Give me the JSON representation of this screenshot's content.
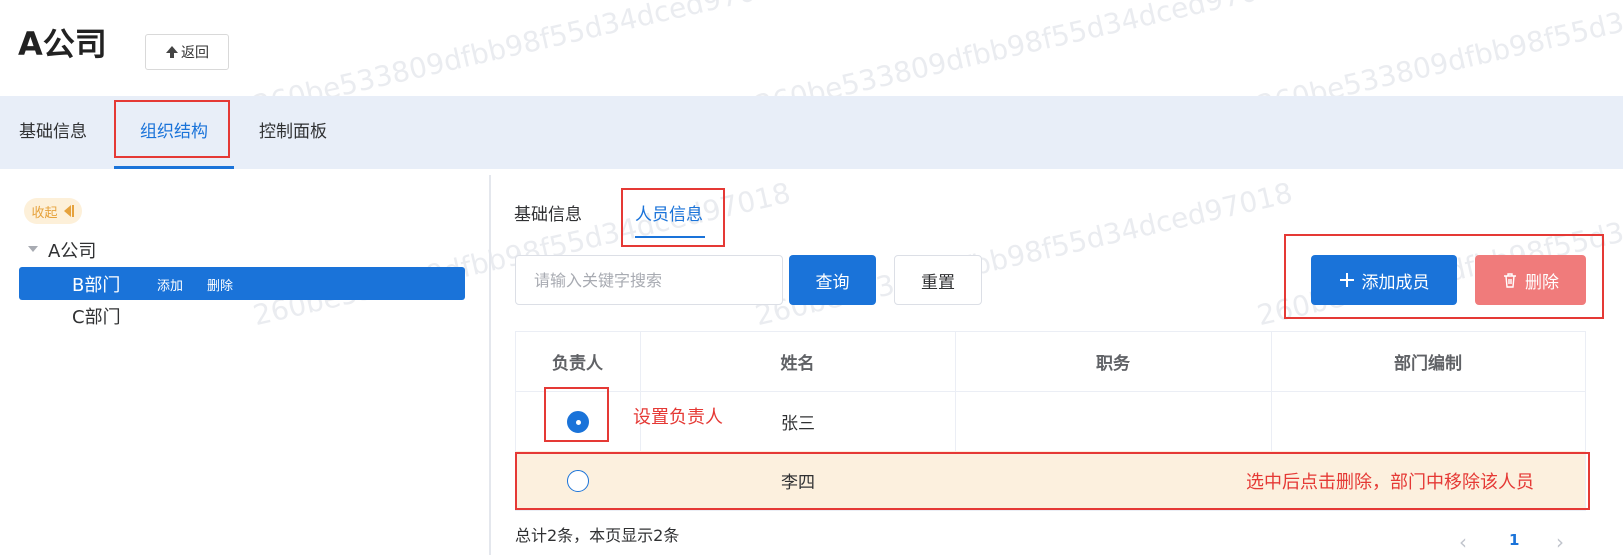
{
  "header": {
    "title": "A公司",
    "back_label": "返回"
  },
  "top_tabs": [
    {
      "label": "基础信息",
      "active": false
    },
    {
      "label": "组织结构",
      "active": true
    },
    {
      "label": "控制面板",
      "active": false
    }
  ],
  "tree": {
    "collapse_label": "收起",
    "root": "A公司",
    "nodes": [
      {
        "label": "B部门",
        "selected": true,
        "actions": [
          "添加",
          "删除"
        ]
      },
      {
        "label": "C部门",
        "selected": false
      }
    ]
  },
  "sub_tabs": [
    {
      "label": "基础信息",
      "active": false
    },
    {
      "label": "人员信息",
      "active": true
    }
  ],
  "search": {
    "placeholder": "请输入关键字搜索",
    "value": "",
    "query_label": "查询",
    "reset_label": "重置"
  },
  "actions": {
    "add_label": "添加成员",
    "delete_label": "删除"
  },
  "table": {
    "headers": [
      "负责人",
      "姓名",
      "职务",
      "部门编制"
    ],
    "rows": [
      {
        "leader": true,
        "name": "张三",
        "title": "",
        "quota": ""
      },
      {
        "leader": false,
        "name": "李四",
        "title": "",
        "quota": ""
      }
    ]
  },
  "annotations": {
    "set_leader": "设置负责人",
    "remove_hint": "选中后点击删除，部门中移除该人员"
  },
  "pagination": {
    "summary": "总计2条，本页显示2条",
    "current_page": "1"
  },
  "watermark": "260be533809dfbb98f55d34dced97018",
  "colors": {
    "primary": "#1a73d9",
    "danger": "#f07b7b",
    "annotation": "#e53935",
    "highlight_row": "#fcf0de",
    "tabs_bar": "#e8eef8"
  }
}
